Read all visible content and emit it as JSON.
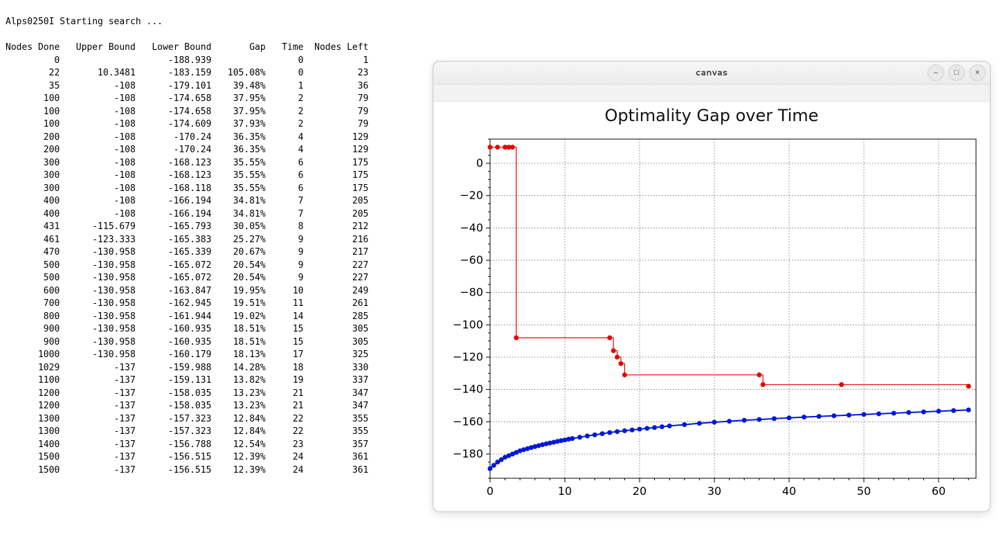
{
  "terminal": {
    "header_line": "Alps0250I Starting search ...",
    "columns": [
      "Nodes Done",
      "Upper Bound",
      "Lower Bound",
      "Gap",
      "Time",
      "Nodes Left"
    ],
    "rows": [
      [
        "0",
        "",
        "-188.939",
        "",
        "0",
        "1"
      ],
      [
        "22",
        "10.3481",
        "-183.159",
        "105.08%",
        "0",
        "23"
      ],
      [
        "35",
        "-108",
        "-179.101",
        "39.48%",
        "1",
        "36"
      ],
      [
        "100",
        "-108",
        "-174.658",
        "37.95%",
        "2",
        "79"
      ],
      [
        "100",
        "-108",
        "-174.658",
        "37.95%",
        "2",
        "79"
      ],
      [
        "100",
        "-108",
        "-174.609",
        "37.93%",
        "2",
        "79"
      ],
      [
        "200",
        "-108",
        "-170.24",
        "36.35%",
        "4",
        "129"
      ],
      [
        "200",
        "-108",
        "-170.24",
        "36.35%",
        "4",
        "129"
      ],
      [
        "300",
        "-108",
        "-168.123",
        "35.55%",
        "6",
        "175"
      ],
      [
        "300",
        "-108",
        "-168.123",
        "35.55%",
        "6",
        "175"
      ],
      [
        "300",
        "-108",
        "-168.118",
        "35.55%",
        "6",
        "175"
      ],
      [
        "400",
        "-108",
        "-166.194",
        "34.81%",
        "7",
        "205"
      ],
      [
        "400",
        "-108",
        "-166.194",
        "34.81%",
        "7",
        "205"
      ],
      [
        "431",
        "-115.679",
        "-165.793",
        "30.05%",
        "8",
        "212"
      ],
      [
        "461",
        "-123.333",
        "-165.383",
        "25.27%",
        "9",
        "216"
      ],
      [
        "470",
        "-130.958",
        "-165.339",
        "20.67%",
        "9",
        "217"
      ],
      [
        "500",
        "-130.958",
        "-165.072",
        "20.54%",
        "9",
        "227"
      ],
      [
        "500",
        "-130.958",
        "-165.072",
        "20.54%",
        "9",
        "227"
      ],
      [
        "600",
        "-130.958",
        "-163.847",
        "19.95%",
        "10",
        "249"
      ],
      [
        "700",
        "-130.958",
        "-162.945",
        "19.51%",
        "11",
        "261"
      ],
      [
        "800",
        "-130.958",
        "-161.944",
        "19.02%",
        "14",
        "285"
      ],
      [
        "900",
        "-130.958",
        "-160.935",
        "18.51%",
        "15",
        "305"
      ],
      [
        "900",
        "-130.958",
        "-160.935",
        "18.51%",
        "15",
        "305"
      ],
      [
        "1000",
        "-130.958",
        "-160.179",
        "18.13%",
        "17",
        "325"
      ],
      [
        "1029",
        "-137",
        "-159.988",
        "14.28%",
        "18",
        "330"
      ],
      [
        "1100",
        "-137",
        "-159.131",
        "13.82%",
        "19",
        "337"
      ],
      [
        "1200",
        "-137",
        "-158.035",
        "13.23%",
        "21",
        "347"
      ],
      [
        "1200",
        "-137",
        "-158.035",
        "13.23%",
        "21",
        "347"
      ],
      [
        "1300",
        "-137",
        "-157.323",
        "12.84%",
        "22",
        "355"
      ],
      [
        "1300",
        "-137",
        "-157.323",
        "12.84%",
        "22",
        "355"
      ],
      [
        "1400",
        "-137",
        "-156.788",
        "12.54%",
        "23",
        "357"
      ],
      [
        "1500",
        "-137",
        "-156.515",
        "12.39%",
        "24",
        "361"
      ],
      [
        "1500",
        "-137",
        "-156.515",
        "12.39%",
        "24",
        "361"
      ]
    ]
  },
  "window": {
    "title": "canvas",
    "buttons": {
      "minimize": "–",
      "maximize": "□",
      "close": "×"
    }
  },
  "chart_data": {
    "type": "line",
    "title": "Optimality Gap over Time",
    "xlabel": "",
    "ylabel": "",
    "xlim": [
      0,
      65
    ],
    "ylim": [
      -195,
      15
    ],
    "xticks": [
      0,
      10,
      20,
      30,
      40,
      50,
      60
    ],
    "yticks": [
      0,
      -20,
      -40,
      -60,
      -80,
      -100,
      -120,
      -140,
      -160,
      -180
    ],
    "series": [
      {
        "name": "upper",
        "color": "#e60000",
        "step": true,
        "markers": true,
        "x": [
          0,
          1,
          2,
          2.5,
          3,
          3.5,
          16,
          16.5,
          17,
          17.5,
          18,
          36,
          36.5,
          47,
          64
        ],
        "y": [
          10,
          10,
          10,
          10,
          10,
          -108,
          -108,
          -116,
          -120,
          -124,
          -131,
          -131,
          -137,
          -137,
          -138
        ]
      },
      {
        "name": "lower",
        "color": "#0018d8",
        "step": false,
        "markers": true,
        "thick": true,
        "x": [
          0,
          0.5,
          1,
          1.5,
          2,
          2.5,
          3,
          3.5,
          4,
          4.5,
          5,
          5.5,
          6,
          6.5,
          7,
          7.5,
          8,
          8.5,
          9,
          9.5,
          10,
          10.5,
          11,
          12,
          13,
          14,
          15,
          16,
          17,
          18,
          19,
          20,
          21,
          22,
          23,
          24,
          26,
          28,
          30,
          32,
          34,
          36,
          38,
          40,
          42,
          44,
          46,
          48,
          50,
          52,
          54,
          56,
          58,
          60,
          62,
          64
        ],
        "y": [
          -189,
          -187,
          -185,
          -183.5,
          -182,
          -181,
          -180,
          -179,
          -178,
          -177.3,
          -176.7,
          -176,
          -175.4,
          -174.8,
          -174.2,
          -173.7,
          -173.2,
          -172.7,
          -172.2,
          -171.7,
          -171.3,
          -170.8,
          -170.4,
          -169.6,
          -168.8,
          -168.1,
          -167.4,
          -166.7,
          -166.1,
          -165.6,
          -165.1,
          -164.6,
          -164.1,
          -163.6,
          -163.1,
          -162.6,
          -161.8,
          -161,
          -160.3,
          -159.7,
          -159.1,
          -158.6,
          -158.1,
          -157.6,
          -157.1,
          -156.7,
          -156.3,
          -155.9,
          -155.5,
          -155.1,
          -154.7,
          -154.3,
          -153.9,
          -153.5,
          -153.1,
          -152.7
        ]
      }
    ]
  }
}
